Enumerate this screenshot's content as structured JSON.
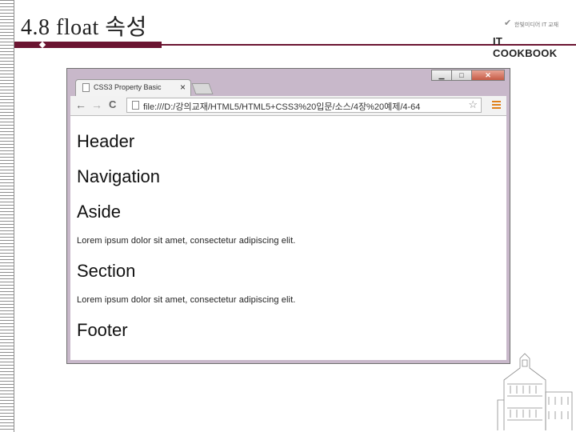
{
  "slide": {
    "title": "4.8 float 속성",
    "logo": {
      "tagline": "한빛미디어 IT 교재",
      "brand": "IT COOKBOOK"
    }
  },
  "browser": {
    "tab": {
      "title": "CSS3 Property Basic",
      "close": "×"
    },
    "window_controls": {
      "minimize": "▁",
      "maximize": "□",
      "close": "✕"
    },
    "nav": {
      "back": "←",
      "forward": "→",
      "reload": "C"
    },
    "address": "file:///D:/강의교재/HTML5/HTML5+CSS3%20입문/소스/4장%20예제/4-64",
    "page": {
      "header": "Header",
      "navigation": "Navigation",
      "aside": "Aside",
      "aside_text": "Lorem ipsum dolor sit amet, consectetur adipiscing elit.",
      "section": "Section",
      "section_text": "Lorem ipsum dolor sit amet, consectetur adipiscing elit.",
      "footer": "Footer"
    }
  },
  "colors": {
    "accent": "#6b1431",
    "frame": "#c8b8ca"
  },
  "icons": [
    "page-icon",
    "star-icon",
    "menu-icon",
    "back-arrow-icon",
    "forward-arrow-icon",
    "reload-icon"
  ]
}
